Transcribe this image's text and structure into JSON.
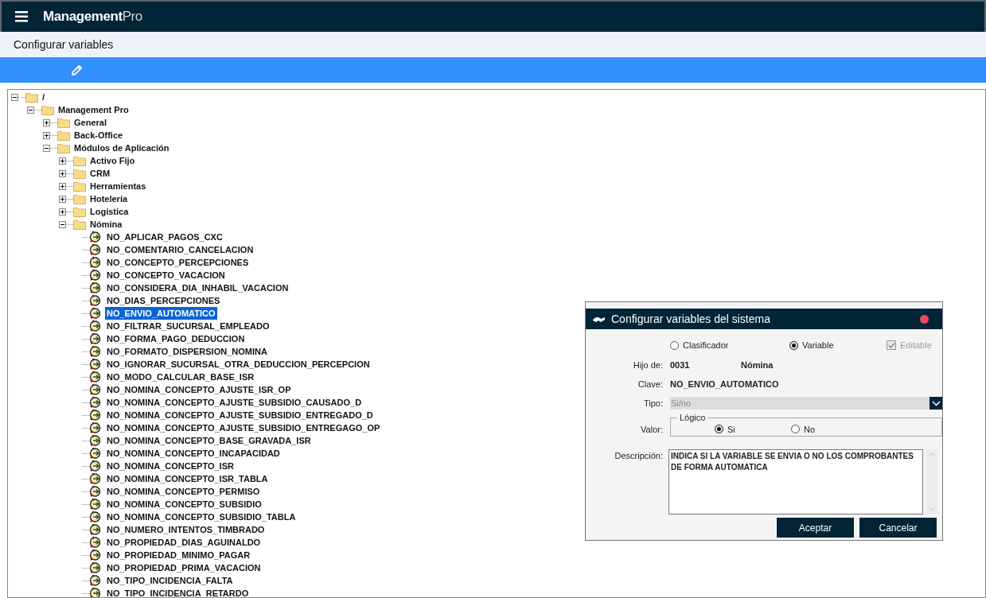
{
  "header": {
    "logo_bold": "Management",
    "logo_light": "Pro"
  },
  "page_title": "Configurar variables",
  "tree": [
    {
      "label": "/",
      "kind": "folder",
      "expanded": true,
      "selected": false,
      "children": [
        {
          "label": "Management Pro",
          "kind": "folder",
          "expanded": true,
          "selected": false,
          "children": [
            {
              "label": "General",
              "kind": "folder",
              "expanded": false,
              "selected": false
            },
            {
              "label": "Back-Office",
              "kind": "folder",
              "expanded": false,
              "selected": false
            },
            {
              "label": "Módulos de Aplicación",
              "kind": "folder",
              "expanded": true,
              "selected": false,
              "children": [
                {
                  "label": "Activo Fijo",
                  "kind": "folder",
                  "expanded": false,
                  "selected": false
                },
                {
                  "label": "CRM",
                  "kind": "folder",
                  "expanded": false,
                  "selected": false
                },
                {
                  "label": "Herramientas",
                  "kind": "folder",
                  "expanded": false,
                  "selected": false
                },
                {
                  "label": "Hotelería",
                  "kind": "folder",
                  "expanded": false,
                  "selected": false
                },
                {
                  "label": "Logística",
                  "kind": "folder",
                  "expanded": false,
                  "selected": false
                },
                {
                  "label": "Nómina",
                  "kind": "folder",
                  "expanded": true,
                  "selected": false,
                  "children": [
                    {
                      "label": "NO_APLICAR_PAGOS_CXC",
                      "kind": "variable",
                      "selected": false
                    },
                    {
                      "label": "NO_COMENTARIO_CANCELACION",
                      "kind": "variable",
                      "selected": false
                    },
                    {
                      "label": "NO_CONCEPTO_PERCEPCIONES",
                      "kind": "variable",
                      "selected": false
                    },
                    {
                      "label": "NO_CONCEPTO_VACACION",
                      "kind": "variable",
                      "selected": false
                    },
                    {
                      "label": "NO_CONSIDERA_DIA_INHABIL_VACACION",
                      "kind": "variable",
                      "selected": false
                    },
                    {
                      "label": "NO_DIAS_PERCEPCIONES",
                      "kind": "variable",
                      "selected": false
                    },
                    {
                      "label": "NO_ENVIO_AUTOMATICO",
                      "kind": "variable",
                      "selected": true
                    },
                    {
                      "label": "NO_FILTRAR_SUCURSAL_EMPLEADO",
                      "kind": "variable",
                      "selected": false
                    },
                    {
                      "label": "NO_FORMA_PAGO_DEDUCCION",
                      "kind": "variable",
                      "selected": false
                    },
                    {
                      "label": "NO_FORMATO_DISPERSION_NOMINA",
                      "kind": "variable",
                      "selected": false
                    },
                    {
                      "label": "NO_IGNORAR_SUCURSAL_OTRA_DEDUCCION_PERCEPCION",
                      "kind": "variable",
                      "selected": false
                    },
                    {
                      "label": "NO_MODO_CALCULAR_BASE_ISR",
                      "kind": "variable",
                      "selected": false
                    },
                    {
                      "label": "NO_NOMINA_CONCEPTO_AJUSTE_ISR_OP",
                      "kind": "variable",
                      "selected": false
                    },
                    {
                      "label": "NO_NOMINA_CONCEPTO_AJUSTE_SUBSIDIO_CAUSADO_D",
                      "kind": "variable",
                      "selected": false
                    },
                    {
                      "label": "NO_NOMINA_CONCEPTO_AJUSTE_SUBSIDIO_ENTREGADO_D",
                      "kind": "variable",
                      "selected": false
                    },
                    {
                      "label": "NO_NOMINA_CONCEPTO_AJUSTE_SUBSIDIO_ENTREGAGO_OP",
                      "kind": "variable",
                      "selected": false
                    },
                    {
                      "label": "NO_NOMINA_CONCEPTO_BASE_GRAVADA_ISR",
                      "kind": "variable",
                      "selected": false
                    },
                    {
                      "label": "NO_NOMINA_CONCEPTO_INCAPACIDAD",
                      "kind": "variable",
                      "selected": false
                    },
                    {
                      "label": "NO_NOMINA_CONCEPTO_ISR",
                      "kind": "variable",
                      "selected": false
                    },
                    {
                      "label": "NO_NOMINA_CONCEPTO_ISR_TABLA",
                      "kind": "variable",
                      "selected": false
                    },
                    {
                      "label": "NO_NOMINA_CONCEPTO_PERMISO",
                      "kind": "variable",
                      "selected": false
                    },
                    {
                      "label": "NO_NOMINA_CONCEPTO_SUBSIDIO",
                      "kind": "variable",
                      "selected": false
                    },
                    {
                      "label": "NO_NOMINA_CONCEPTO_SUBSIDIO_TABLA",
                      "kind": "variable",
                      "selected": false
                    },
                    {
                      "label": "NO_NUMERO_INTENTOS_TIMBRADO",
                      "kind": "variable",
                      "selected": false
                    },
                    {
                      "label": "NO_PROPIEDAD_DIAS_AGUINALDO",
                      "kind": "variable",
                      "selected": false
                    },
                    {
                      "label": "NO_PROPIEDAD_MINIMO_PAGAR",
                      "kind": "variable",
                      "selected": false
                    },
                    {
                      "label": "NO_PROPIEDAD_PRIMA_VACACION",
                      "kind": "variable",
                      "selected": false
                    },
                    {
                      "label": "NO_TIPO_INCIDENCIA_FALTA",
                      "kind": "variable",
                      "selected": false
                    },
                    {
                      "label": "NO_TIPO_INCIDENCIA_RETARDO",
                      "kind": "variable",
                      "selected": false
                    }
                  ]
                }
              ]
            }
          ]
        }
      ]
    }
  ],
  "dialog": {
    "title": "Configurar variables del sistema",
    "node_types": [
      {
        "label": "Clasificador",
        "selected": false
      },
      {
        "label": "Variable",
        "selected": true
      }
    ],
    "editable": {
      "label": "Editable",
      "checked": true,
      "disabled": true
    },
    "parent": {
      "label": "Hijo de:",
      "code": "0031",
      "name": "Nómina"
    },
    "key": {
      "label": "Clave:",
      "value": "NO_ENVIO_AUTOMATICO"
    },
    "type": {
      "label": "Tipo:",
      "value": "Si/no",
      "disabled": true
    },
    "value": {
      "label": "Valor:",
      "legend": "Lógico",
      "options": [
        {
          "label": "Si",
          "selected": true
        },
        {
          "label": "No",
          "selected": false
        }
      ]
    },
    "description": {
      "label": "Descripción:",
      "value": "INDICA SI LA VARIABLE SE ENVIA O NO LOS COMPROBANTES DE FORMA AUTOMATICA"
    },
    "buttons": [
      "Aceptar",
      "Cancelar"
    ]
  }
}
